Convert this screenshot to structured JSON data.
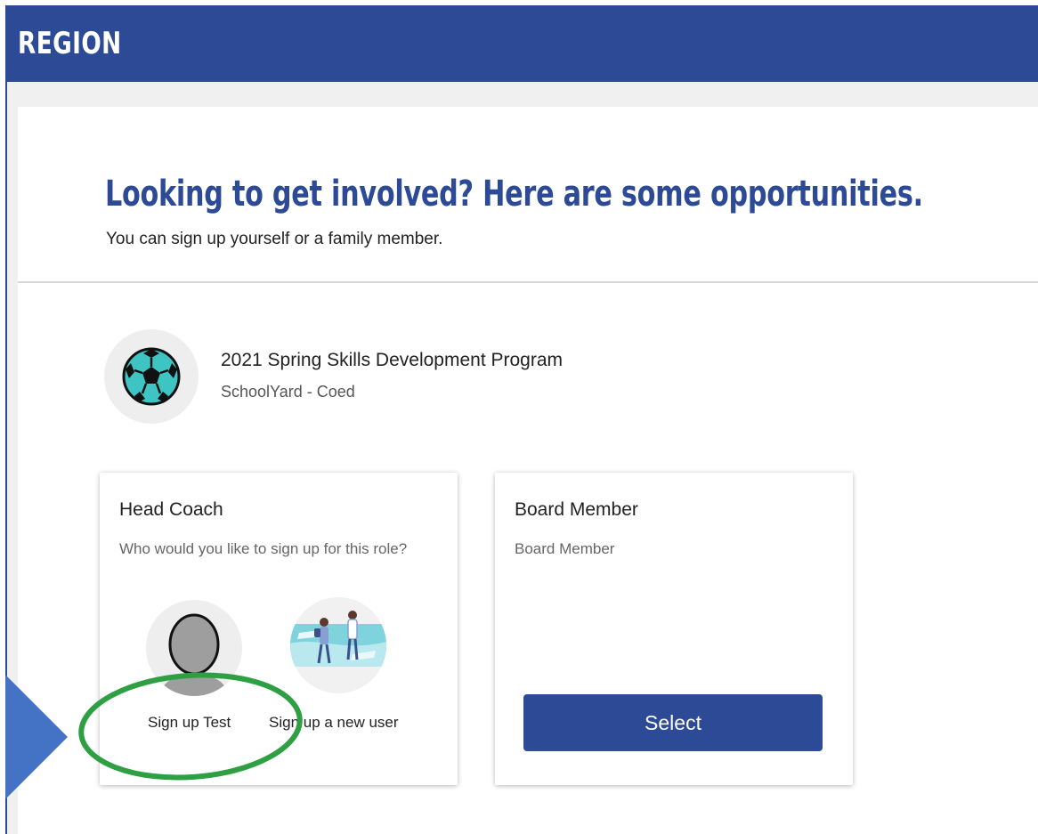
{
  "header": {
    "brand": "REGION",
    "color": "#2d4a96"
  },
  "intro": {
    "headline": "Looking to get involved? Here are some opportunities.",
    "subline": "You can sign up yourself or a family member."
  },
  "program": {
    "icon": "soccer-ball-icon",
    "title": "2021 Spring Skills Development Program",
    "subtitle": "SchoolYard - Coed"
  },
  "roles": [
    {
      "title": "Head Coach",
      "description": "Who would you like to sign up for this role?",
      "options": [
        {
          "label": "Sign up Test",
          "icon": "person-silhouette-icon"
        },
        {
          "label": "Sign up a new user",
          "icon": "people-illustration-icon"
        }
      ]
    },
    {
      "title": "Board Member",
      "description": "Board Member",
      "button": "Select"
    }
  ],
  "annotations": {
    "arrow_color": "#4472c4",
    "circle_color": "#2ea043"
  }
}
